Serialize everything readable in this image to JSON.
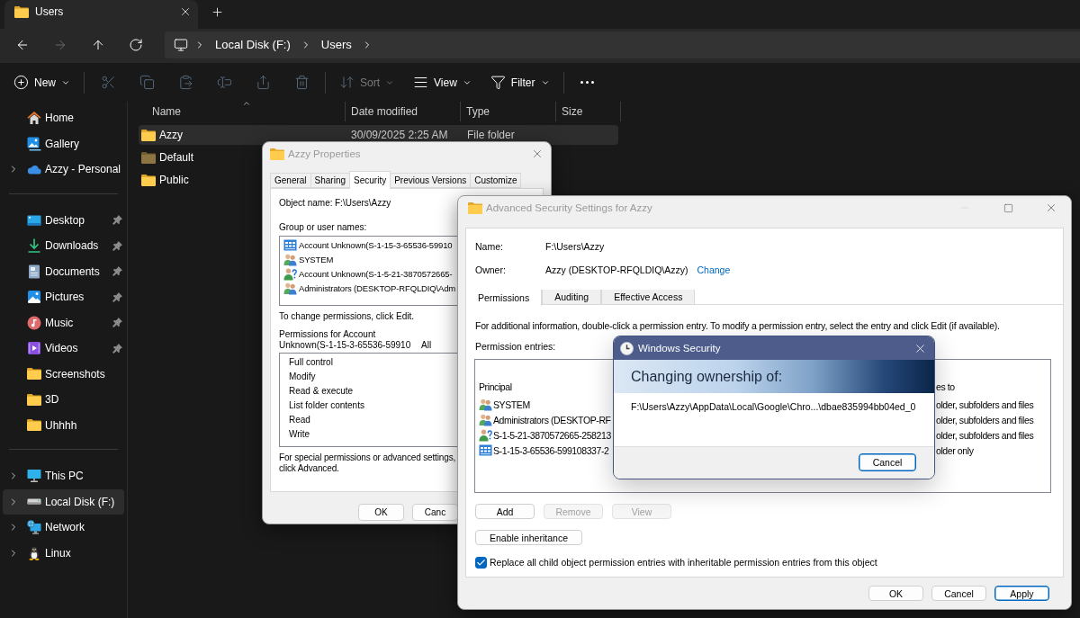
{
  "explorer": {
    "tabs": [
      {
        "title": "Users",
        "selected": true
      }
    ],
    "nav": [
      {
        "kind": "back",
        "disabled": false
      },
      {
        "kind": "forward",
        "disabled": true
      },
      {
        "kind": "up",
        "disabled": false
      },
      {
        "kind": "refresh",
        "disabled": false
      }
    ],
    "address": {
      "crumbs": [
        "Local Disk (F:)",
        "Users"
      ]
    },
    "toolbar": {
      "groups": [
        {
          "items": [
            {
              "kind": "new",
              "label": "New",
              "disabled": false,
              "menu": true
            }
          ]
        },
        {
          "items": [
            {
              "kind": "cut",
              "disabled": true,
              "menu": false
            },
            {
              "kind": "copy",
              "disabled": true,
              "menu": false
            },
            {
              "kind": "paste",
              "disabled": true,
              "menu": false
            },
            {
              "kind": "rename",
              "disabled": true,
              "menu": false
            },
            {
              "kind": "share",
              "disabled": true,
              "menu": false
            },
            {
              "kind": "delete",
              "disabled": true,
              "menu": false
            }
          ]
        },
        {
          "items": [
            {
              "kind": "sort",
              "label": "Sort",
              "disabled": true,
              "menu": true
            },
            {
              "kind": "view",
              "label": "View",
              "disabled": false,
              "menu": true
            },
            {
              "kind": "filter",
              "label": "Filter",
              "disabled": false,
              "menu": true
            }
          ]
        },
        {
          "items": [
            {
              "kind": "more",
              "disabled": false,
              "menu": false
            }
          ]
        }
      ]
    },
    "sidebar": {
      "groups": [
        {
          "items": [
            {
              "kind": "home",
              "label": "Home",
              "expandable": false,
              "pinned": false,
              "selected": false
            },
            {
              "kind": "gallery",
              "label": "Gallery",
              "expandable": false,
              "pinned": false,
              "selected": false
            },
            {
              "kind": "cloud",
              "label": "Azzy - Personal",
              "expandable": true,
              "pinned": false,
              "selected": false
            }
          ]
        },
        {
          "items": [
            {
              "kind": "desktop",
              "label": "Desktop",
              "expandable": false,
              "pinned": true,
              "selected": false
            },
            {
              "kind": "downloads",
              "label": "Downloads",
              "expandable": false,
              "pinned": true,
              "selected": false
            },
            {
              "kind": "documents",
              "label": "Documents",
              "expandable": false,
              "pinned": true,
              "selected": false
            },
            {
              "kind": "pictures",
              "label": "Pictures",
              "expandable": false,
              "pinned": true,
              "selected": false
            },
            {
              "kind": "music",
              "label": "Music",
              "expandable": false,
              "pinned": true,
              "selected": false
            },
            {
              "kind": "videos",
              "label": "Videos",
              "expandable": false,
              "pinned": true,
              "selected": false
            },
            {
              "kind": "folder",
              "label": "Screenshots",
              "expandable": false,
              "pinned": false,
              "selected": false
            },
            {
              "kind": "folder",
              "label": "3D",
              "expandable": false,
              "pinned": false,
              "selected": false
            },
            {
              "kind": "folder",
              "label": "Uhhhh",
              "expandable": false,
              "pinned": false,
              "selected": false
            }
          ]
        },
        {
          "items": [
            {
              "kind": "pc",
              "label": "This PC",
              "expandable": true,
              "pinned": false,
              "selected": false
            },
            {
              "kind": "drive",
              "label": "Local Disk (F:)",
              "expandable": true,
              "pinned": false,
              "selected": true
            },
            {
              "kind": "network",
              "label": "Network",
              "expandable": true,
              "pinned": false,
              "selected": false
            },
            {
              "kind": "linux",
              "label": "Linux",
              "expandable": true,
              "pinned": false,
              "selected": false
            }
          ]
        }
      ]
    },
    "file_list": {
      "columns": [
        {
          "label": "Name",
          "sorted": true
        },
        {
          "label": "Date modified",
          "sorted": false
        },
        {
          "label": "Type",
          "sorted": false
        },
        {
          "label": "Size",
          "sorted": false
        }
      ],
      "rows": [
        {
          "name": "Azzy",
          "date_modified": "30/09/2025 2:25 AM",
          "type": "File folder",
          "selected": true,
          "hidden": false
        },
        {
          "name": "Default",
          "selected": false,
          "hidden": true
        },
        {
          "name": "Public",
          "selected": false,
          "hidden": false
        }
      ]
    }
  },
  "properties_dialog": {
    "title": "Azzy Properties",
    "active": false,
    "controls": [
      {
        "kind": "close",
        "disabled": false
      }
    ],
    "tabs": [
      {
        "label": "General",
        "selected": false
      },
      {
        "label": "Sharing",
        "selected": false
      },
      {
        "label": "Security",
        "selected": true
      },
      {
        "label": "Previous Versions",
        "selected": false
      },
      {
        "label": "Customize",
        "selected": false
      }
    ],
    "object_name": {
      "label": "Object name:",
      "value": "F:\\Users\\Azzy"
    },
    "group_label": "Group or user names:",
    "principals": [
      {
        "kind": "app-package",
        "name": "Account Unknown(S-1-15-3-65536-59910"
      },
      {
        "kind": "group",
        "name": "SYSTEM"
      },
      {
        "kind": "unknown-user",
        "name": "Account Unknown(S-1-5-21-3870572665-"
      },
      {
        "kind": "group",
        "name": "Administrators (DESKTOP-RFQLDIQ\\Adm"
      }
    ],
    "edit_hint": "To change permissions, click Edit.",
    "permissions_heading": "Permissions for Account Unknown(S-1-15-3-65536-59910",
    "column_header": "All",
    "permissions": [
      "Full control",
      "Modify",
      "Read & execute",
      "List folder contents",
      "Read",
      "Write"
    ],
    "advanced_hint": "For special permissions or advanced settings, click Advanced.",
    "buttons": [
      {
        "label": "OK"
      },
      {
        "label": "Canc"
      }
    ]
  },
  "advanced_security": {
    "title": "Advanced Security Settings for Azzy",
    "active": false,
    "controls": [
      {
        "kind": "minimize",
        "disabled": true
      },
      {
        "kind": "maximize",
        "disabled": false
      },
      {
        "kind": "close",
        "disabled": false
      }
    ],
    "name": {
      "label": "Name:",
      "value": "F:\\Users\\Azzy"
    },
    "owner": {
      "label": "Owner:",
      "value": "Azzy (DESKTOP-RFQLDIQ\\Azzy)",
      "link": "Change"
    },
    "tabs": [
      {
        "label": "Permissions",
        "selected": true
      },
      {
        "label": "Auditing",
        "selected": false
      },
      {
        "label": "Effective Access",
        "selected": false
      }
    ],
    "info": "For additional information, double-click a permission entry. To modify a permission entry, select the entry and click Edit (if available).",
    "entries_label": "Permission entries:",
    "columns": [
      "Principal",
      "es to"
    ],
    "entries": [
      {
        "kind": "group",
        "principal": "SYSTEM",
        "right_column": "older, subfolders and files"
      },
      {
        "kind": "group",
        "principal": "Administrators (DESKTOP-RF",
        "right_column": "older, subfolders and files"
      },
      {
        "kind": "unknown-user",
        "principal": "S-1-5-21-3870572665-258213",
        "right_column": "older, subfolders and files"
      },
      {
        "kind": "app-package",
        "principal": "S-1-15-3-65536-599108337-2",
        "right_column": "older only"
      }
    ],
    "entry_buttons": [
      {
        "label": "Add",
        "disabled": false
      },
      {
        "label": "Remove",
        "disabled": true
      },
      {
        "label": "View",
        "disabled": true
      }
    ],
    "inheritance_button": "Enable inheritance",
    "replace_child": {
      "label": "Replace all child object permission entries with inheritable permission entries from this object",
      "checked": true
    },
    "buttons": [
      {
        "label": "OK",
        "default": false
      },
      {
        "label": "Cancel",
        "default": false
      },
      {
        "label": "Apply",
        "default": true
      }
    ]
  },
  "security_dialog": {
    "title": "Windows Security",
    "active": true,
    "controls": [
      {
        "kind": "close",
        "disabled": false
      }
    ],
    "heading": "Changing ownership of:",
    "path": "F:\\Users\\Azzy\\AppData\\Local\\Google\\Chro...\\dbae835994bb04ed_0",
    "buttons": [
      {
        "label": "Cancel",
        "default": true
      }
    ]
  }
}
